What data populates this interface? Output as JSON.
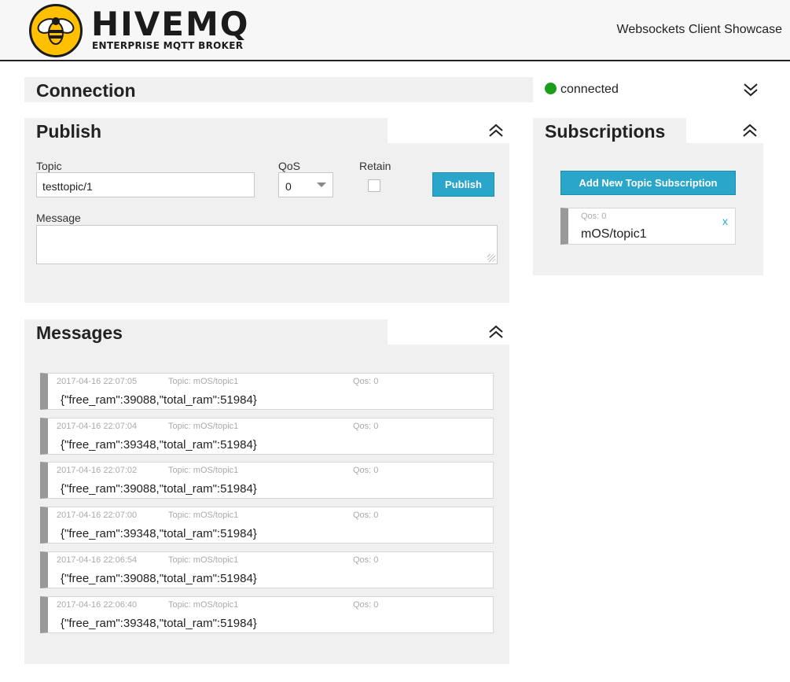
{
  "header": {
    "logo_text": "HIVEMQ",
    "logo_subtitle": "ENTERPRISE MQTT BROKER",
    "page_title": "Websockets Client Showcase"
  },
  "connection": {
    "title": "Connection",
    "status": "connected",
    "status_color": "#1a9e1a"
  },
  "publish": {
    "title": "Publish",
    "topic_label": "Topic",
    "topic_value": "testtopic/1",
    "qos_label": "QoS",
    "qos_value": "0",
    "retain_label": "Retain",
    "publish_button": "Publish",
    "message_label": "Message",
    "message_value": ""
  },
  "subscriptions": {
    "title": "Subscriptions",
    "add_button": "Add New Topic Subscription",
    "items": [
      {
        "qos": "Qos: 0",
        "topic": "mOS/topic1",
        "remove": "x"
      }
    ]
  },
  "messages": {
    "title": "Messages",
    "items": [
      {
        "timestamp": "2017-04-16 22:07:05",
        "topic": "Topic: mOS/topic1",
        "qos": "Qos: 0",
        "payload": "{\"free_ram\":39088,\"total_ram\":51984}"
      },
      {
        "timestamp": "2017-04-16 22:07:04",
        "topic": "Topic: mOS/topic1",
        "qos": "Qos: 0",
        "payload": "{\"free_ram\":39348,\"total_ram\":51984}"
      },
      {
        "timestamp": "2017-04-16 22:07:02",
        "topic": "Topic: mOS/topic1",
        "qos": "Qos: 0",
        "payload": "{\"free_ram\":39088,\"total_ram\":51984}"
      },
      {
        "timestamp": "2017-04-16 22:07:00",
        "topic": "Topic: mOS/topic1",
        "qos": "Qos: 0",
        "payload": "{\"free_ram\":39348,\"total_ram\":51984}"
      },
      {
        "timestamp": "2017-04-16 22:06:54",
        "topic": "Topic: mOS/topic1",
        "qos": "Qos: 0",
        "payload": "{\"free_ram\":39088,\"total_ram\":51984}"
      },
      {
        "timestamp": "2017-04-16 22:06:40",
        "topic": "Topic: mOS/topic1",
        "qos": "Qos: 0",
        "payload": "{\"free_ram\":39348,\"total_ram\":51984}"
      }
    ]
  },
  "colors": {
    "accent": "#2ba6cb",
    "logo_yellow": "#ffc000",
    "panel_bg": "#f0f0f0"
  }
}
